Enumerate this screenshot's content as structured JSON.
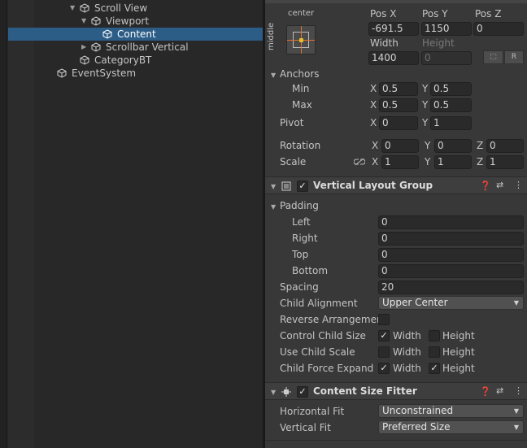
{
  "hierarchy": {
    "items": [
      {
        "label": "Scroll View",
        "expanded": true
      },
      {
        "label": "Viewport",
        "expanded": true
      },
      {
        "label": "Content",
        "selected": true
      },
      {
        "label": "Scrollbar Vertical",
        "expanded": false
      },
      {
        "label": "CategoryBT"
      },
      {
        "label": "EventSystem"
      }
    ]
  },
  "rect_transform": {
    "anchor_h": "center",
    "anchor_v": "middle",
    "pos_x_label": "Pos X",
    "pos_y_label": "Pos Y",
    "pos_z_label": "Pos Z",
    "pos_x": "-691.5",
    "pos_y": "1150",
    "pos_z": "0",
    "width_label": "Width",
    "height_label": "Height",
    "width": "1400",
    "height": "0",
    "raw_btn": "R",
    "anchors_label": "Anchors",
    "min_label": "Min",
    "max_label": "Max",
    "min_x": "0.5",
    "min_y": "0.5",
    "max_x": "0.5",
    "max_y": "0.5",
    "pivot_label": "Pivot",
    "pivot_x": "0",
    "pivot_y": "1",
    "rotation_label": "Rotation",
    "rot_x": "0",
    "rot_y": "0",
    "rot_z": "0",
    "scale_label": "Scale",
    "scale_x": "1",
    "scale_y": "1",
    "scale_z": "1",
    "axis_x": "X",
    "axis_y": "Y",
    "axis_z": "Z"
  },
  "vertical_layout_group": {
    "title": "Vertical Layout Group",
    "enabled": true,
    "padding_label": "Padding",
    "left_label": "Left",
    "right_label": "Right",
    "top_label": "Top",
    "bottom_label": "Bottom",
    "left": "0",
    "right": "0",
    "top": "0",
    "bottom": "0",
    "spacing_label": "Spacing",
    "spacing": "20",
    "child_alignment_label": "Child Alignment",
    "child_alignment": "Upper Center",
    "reverse_label": "Reverse Arrangemen",
    "control_child_size_label": "Control Child Size",
    "use_child_scale_label": "Use Child Scale",
    "child_force_expand_label": "Child Force Expand",
    "width_label": "Width",
    "height_label": "Height",
    "checks": {
      "control_width": true,
      "control_height": false,
      "scale_width": false,
      "scale_height": false,
      "expand_width": true,
      "expand_height": true,
      "reverse": false
    }
  },
  "content_size_fitter": {
    "title": "Content Size Fitter",
    "enabled": true,
    "horizontal_fit_label": "Horizontal Fit",
    "horizontal_fit": "Unconstrained",
    "vertical_fit_label": "Vertical Fit",
    "vertical_fit": "Preferred Size"
  },
  "colors": {
    "selection": "#2c5d87",
    "anchor_orange": "#e07030"
  }
}
